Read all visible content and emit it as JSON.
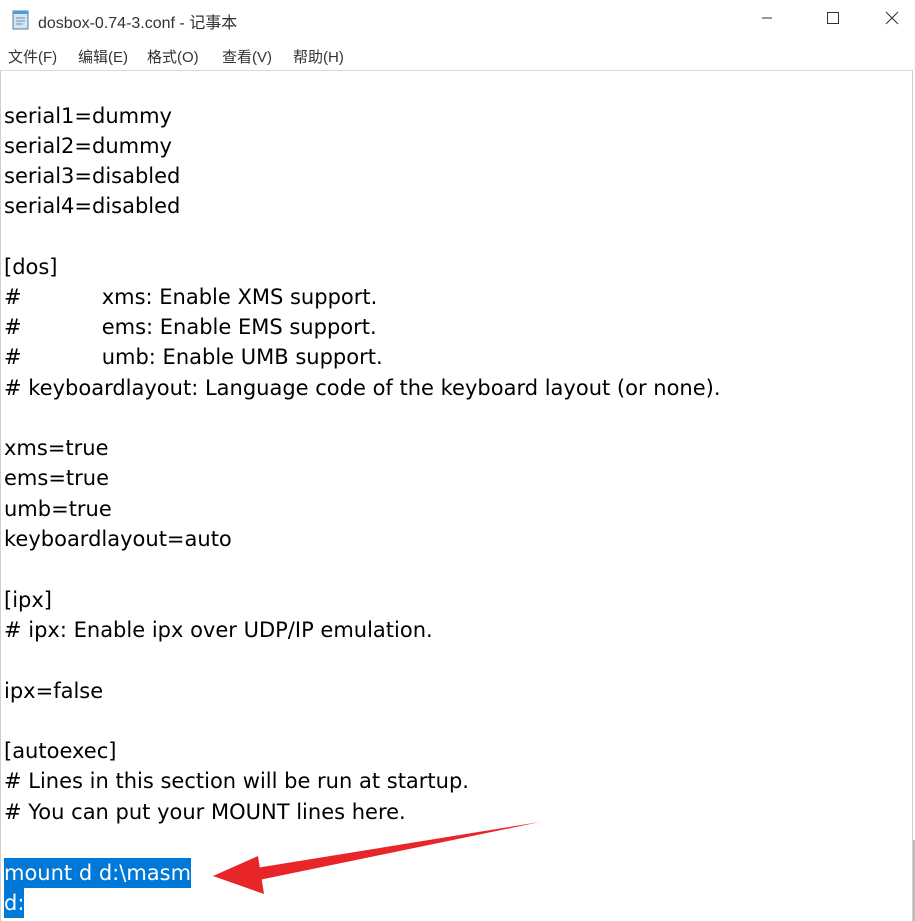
{
  "window": {
    "title": "dosbox-0.74-3.conf - 记事本",
    "app_icon": "notepad-icon",
    "controls": {
      "minimize_icon": "minimize-icon",
      "maximize_icon": "maximize-icon",
      "close_icon": "close-icon"
    }
  },
  "menubar": {
    "items": [
      {
        "label": "文件(F)"
      },
      {
        "label": "编辑(E)"
      },
      {
        "label": "格式(O)"
      },
      {
        "label": "查看(V)"
      },
      {
        "label": "帮助(H)"
      }
    ]
  },
  "editor": {
    "lines": [
      "serial1=dummy",
      "serial2=dummy",
      "serial3=disabled",
      "serial4=disabled",
      "",
      "[dos]",
      "#            xms: Enable XMS support.",
      "#            ems: Enable EMS support.",
      "#            umb: Enable UMB support.",
      "# keyboardlayout: Language code of the keyboard layout (or none).",
      "",
      "xms=true",
      "ems=true",
      "umb=true",
      "keyboardlayout=auto",
      "",
      "[ipx]",
      "# ipx: Enable ipx over UDP/IP emulation.",
      "",
      "ipx=false",
      "",
      "[autoexec]",
      "# Lines in this section will be run at startup.",
      "# You can put your MOUNT lines here.",
      "",
      "mount d d:\\masm",
      "d:"
    ],
    "selected_line_indices": [
      25,
      26
    ],
    "selection_color": "#0078d7"
  },
  "annotation": {
    "arrow_color": "#e8262a",
    "points_to": "mount d d:\\masm"
  }
}
